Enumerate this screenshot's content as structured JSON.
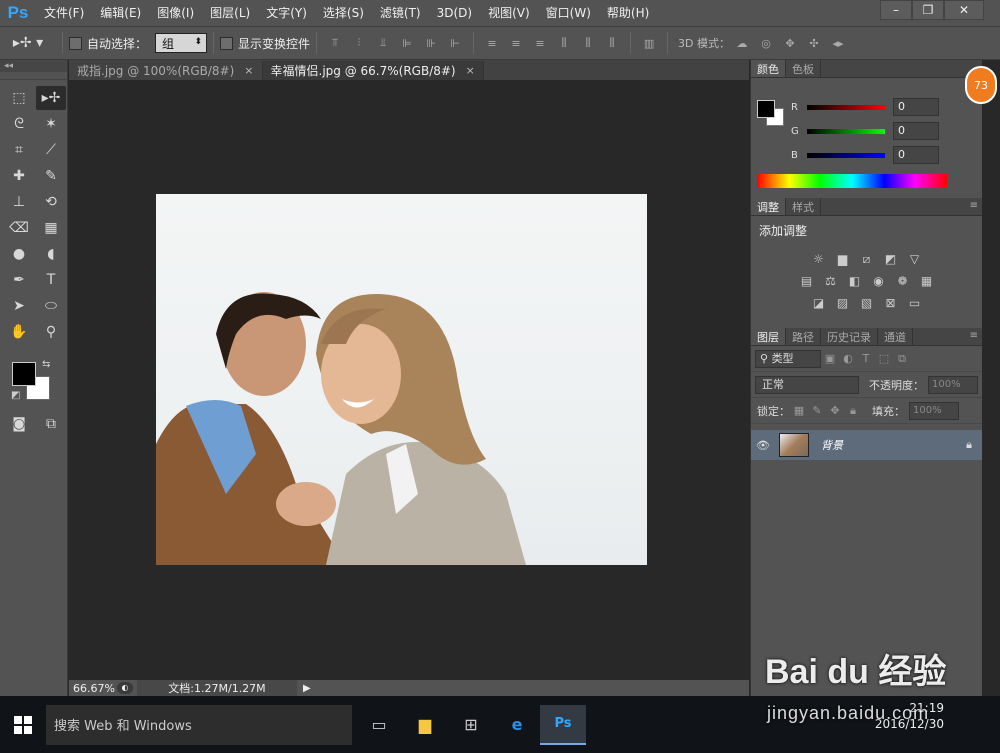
{
  "app": {
    "logo": "Ps"
  },
  "menu": [
    "文件(F)",
    "编辑(E)",
    "图像(I)",
    "图层(L)",
    "文字(Y)",
    "选择(S)",
    "滤镜(T)",
    "3D(D)",
    "视图(V)",
    "窗口(W)",
    "帮助(H)"
  ],
  "options": {
    "auto_select_label": "自动选择：",
    "auto_select_value": "组",
    "show_transform_label": "显示变换控件",
    "mode3d_label": "3D 模式："
  },
  "tabs": [
    {
      "label": "戒指.jpg @ 100%(RGB/8#)",
      "active": false
    },
    {
      "label": "幸福情侣.jpg @ 66.7%(RGB/8#)",
      "active": true
    }
  ],
  "status": {
    "zoom": "66.67%",
    "doc": "文档:1.27M/1.27M"
  },
  "color_panel": {
    "tabs": [
      "颜色",
      "色板"
    ],
    "channels": [
      {
        "name": "R",
        "value": "0",
        "color": "#ff0000"
      },
      {
        "name": "G",
        "value": "0",
        "color": "#00ff00"
      },
      {
        "name": "B",
        "value": "0",
        "color": "#0000ff"
      }
    ]
  },
  "adjust_panel": {
    "tabs": [
      "调整",
      "样式"
    ],
    "title": "添加调整"
  },
  "layers_panel": {
    "tabs": [
      "图层",
      "路径",
      "历史记录",
      "通道"
    ],
    "kind_filter": "类型",
    "blend_mode": "正常",
    "opacity_label": "不透明度：",
    "opacity_value": "100%",
    "lock_label": "锁定：",
    "fill_label": "填充：",
    "fill_value": "100%",
    "layers": [
      {
        "name": "背景"
      }
    ]
  },
  "badge": "73",
  "taskbar": {
    "search_placeholder": "搜索 Web 和 Windows",
    "time": "21:19",
    "date": "2016/12/30"
  },
  "watermark": {
    "main": "Bai du 经验",
    "sub": "jingyan.baidu.com"
  }
}
